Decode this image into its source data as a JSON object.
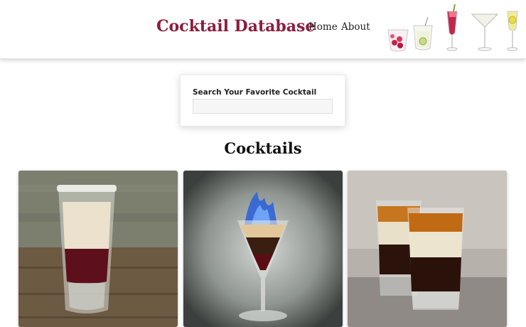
{
  "header": {
    "brand": "Cocktail Database",
    "nav": {
      "home": "Home",
      "about": "About"
    }
  },
  "search": {
    "label": "Search Your Favorite Cocktail",
    "placeholder": "",
    "value": ""
  },
  "section": {
    "title": "Cocktails"
  },
  "colors": {
    "brand": "#8b1d3d",
    "text": "#222222"
  },
  "cocktails": [
    {
      "image": "layered-shot-red-cream"
    },
    {
      "image": "flaming-shot-martini-glass"
    },
    {
      "image": "layered-shots-pair"
    }
  ]
}
